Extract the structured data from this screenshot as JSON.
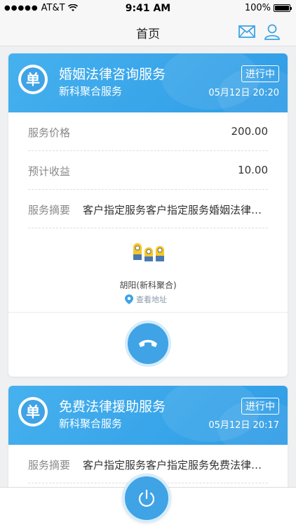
{
  "status_bar": {
    "carrier": "AT&T",
    "time": "9:41 AM",
    "battery": "100%"
  },
  "nav": {
    "title": "首页",
    "mail_icon": "mail-icon",
    "user_icon": "user-icon"
  },
  "colors": {
    "primary": "#3fa3e6",
    "header_gradient_start": "#46b1ee",
    "background": "#eef0f2"
  },
  "orders": [
    {
      "title": "婚姻法律咨询服务",
      "provider": "新科聚合服务",
      "status": "进行中",
      "time": "05月12日 20:20",
      "rows": [
        {
          "label": "服务价格",
          "value": "200.00"
        },
        {
          "label": "预计收益",
          "value": "10.00"
        },
        {
          "label": "服务摘要",
          "value": "客户指定服务客户指定服务婚姻法律咨询服务"
        }
      ],
      "contact_name": "胡阳(新科聚合)",
      "address_link": "查看地址",
      "call_icon": "phone-hangup-icon"
    },
    {
      "title": "免费法律援助服务",
      "provider": "新科聚合服务",
      "status": "进行中",
      "time": "05月12日 20:17",
      "rows": [
        {
          "label": "服务摘要",
          "value": "客户指定服务客户指定服务免费法律援助服务"
        }
      ]
    }
  ],
  "bottom": {
    "power_icon": "power-icon"
  }
}
